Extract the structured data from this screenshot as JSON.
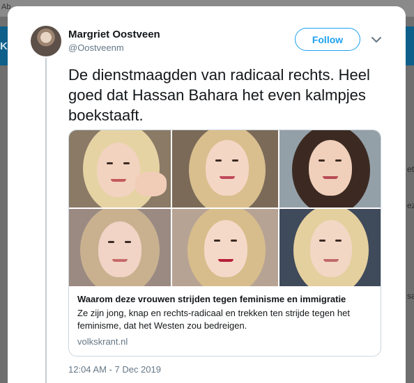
{
  "background": {
    "fragments": [
      "Ab",
      "K",
      "et",
      "ez",
      "sa"
    ]
  },
  "tweet": {
    "author_name": "Margriet Oostveen",
    "author_handle": "@Oostveenm",
    "follow_label": "Follow",
    "text": "De dienstmaagden van radicaal rechts. Heel goed dat Hassan Bahara het even kalmpjes boekstaaft.",
    "timestamp": "12:04 AM - 7 Dec 2019"
  },
  "link_card": {
    "title": "Waarom deze vrouwen strijden tegen feminisme en immigratie",
    "description": "Ze zijn jong, knap en rechts-radicaal en trekken ten strijde tegen het feminisme, dat het Westen zou bedreigen.",
    "domain": "volkskrant.nl",
    "photo_count": 6
  },
  "colors": {
    "accent": "#1da1f2",
    "secondary_text": "#657786",
    "border": "#ccd6dd",
    "backdrop": "#6f6f6f"
  },
  "icons": [
    "chevron-down-icon",
    "avatar"
  ]
}
